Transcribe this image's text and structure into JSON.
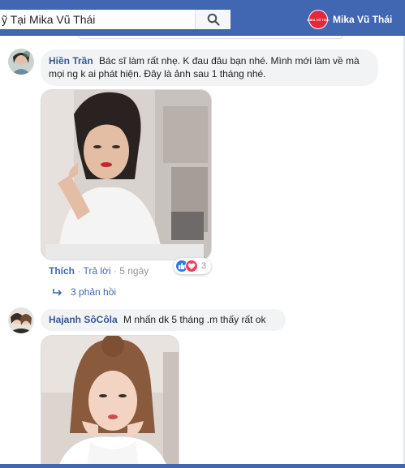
{
  "search": {
    "value": "ỹ Tại Mika Vũ Thái"
  },
  "page": {
    "logo_text": "MIKA VŨ THÁI",
    "name": "Mika Vũ Thái"
  },
  "comments": [
    {
      "author": "Hiền Trần",
      "text": "Bác sĩ làm rất nhẹ. K đau đâu bạn nhé. Mình mới làm về mà mọi ng k ai phát hiện. Đây là ảnh sau 1 tháng nhé.",
      "actions": {
        "like": "Thích",
        "reply": "Trả lời",
        "time": "5 ngày"
      },
      "reaction_count": "3",
      "replies_label": "3 phản hồi"
    },
    {
      "author": "Hajanh SôCôla",
      "text": "M nhấn dk 5 tháng .m thấy rất ok"
    }
  ],
  "colors": {
    "brand": "#4267b2",
    "author": "#385898",
    "bubble": "#f2f3f5"
  }
}
